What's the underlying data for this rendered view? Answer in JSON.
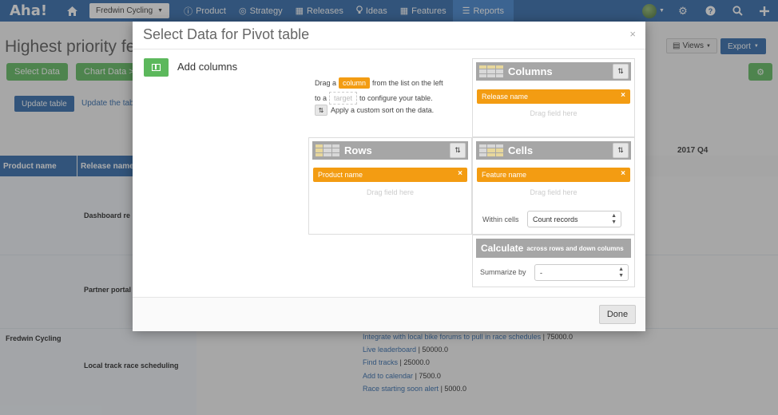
{
  "nav": {
    "logo": "Aha!",
    "product_select": "Fredwin Cycling",
    "items": [
      {
        "label": "Product",
        "icon": "info-circle-icon",
        "glyph": "ⓘ"
      },
      {
        "label": "Strategy",
        "icon": "target-icon",
        "glyph": "◎"
      },
      {
        "label": "Releases",
        "icon": "calendar-icon",
        "glyph": "▦"
      },
      {
        "label": "Ideas",
        "icon": "lightbulb-icon",
        "glyph": "♀"
      },
      {
        "label": "Features",
        "icon": "grid-icon",
        "glyph": "▦"
      },
      {
        "label": "Reports",
        "icon": "reports-icon",
        "glyph": "☰"
      }
    ],
    "active": "Reports",
    "right_icons": [
      "avatar",
      "gear-icon",
      "help-icon",
      "search-icon",
      "plus-icon"
    ]
  },
  "page": {
    "title": "Highest priority featu",
    "select_data_label": "Select Data",
    "chart_data_label": "Chart Data >",
    "update_table_label": "Update table",
    "update_table_link": "Update the tab",
    "views_label": "Views",
    "export_label": "Export",
    "table": {
      "headers": [
        "Product name",
        "Release name"
      ],
      "quarter_header": "2017 Q4",
      "product": "Fredwin Cycling",
      "releases": [
        "Dashboard re",
        "Partner portal",
        "Local track race scheduling"
      ],
      "features": [
        {
          "name": "Integrate with local bike forums to pull in race schedules",
          "value": "| 75000.0"
        },
        {
          "name": "Live leaderboard",
          "value": "| 50000.0"
        },
        {
          "name": "Find tracks",
          "value": "| 25000.0"
        },
        {
          "name": "Add to calendar",
          "value": "| 7500.0"
        },
        {
          "name": "Race starting soon alert",
          "value": "| 5000.0"
        }
      ]
    }
  },
  "modal": {
    "title": "Select Data for Pivot table",
    "close": "×",
    "add_columns": "Add columns",
    "instructions": {
      "line1_pre": "Drag a",
      "line1_pill": "column",
      "line1_post": "from the list on the left",
      "line2_pre": "to a",
      "line2_pill": "target",
      "line2_post": "to configure your table.",
      "line3": "Apply a custom sort on the data."
    },
    "columns": {
      "title": "Columns",
      "tags": [
        "Release name"
      ],
      "hint": "Drag field here"
    },
    "rows": {
      "title": "Rows",
      "tags": [
        "Product name"
      ],
      "hint": "Drag field here"
    },
    "cells": {
      "title": "Cells",
      "tags": [
        "Feature name"
      ],
      "hint": "Drag field here",
      "within_label": "Within cells",
      "within_value": "Count records"
    },
    "calculate": {
      "title": "Calculate",
      "subtitle": "across rows and down columns",
      "summarize_label": "Summarize by",
      "summarize_value": "-"
    },
    "done_label": "Done"
  }
}
